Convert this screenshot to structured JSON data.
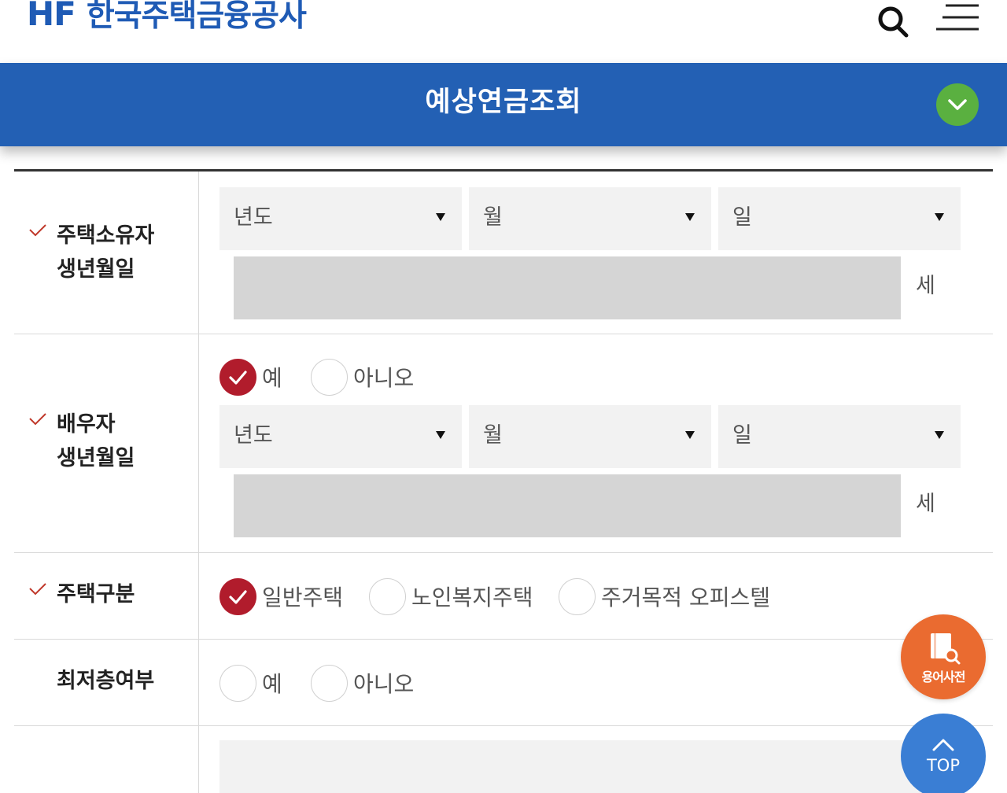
{
  "header": {
    "logo_abbr": "HF",
    "logo_name": "한국주택금융공사",
    "search_icon": "search-icon",
    "menu_icon": "hamburger-menu-icon"
  },
  "titlebar": {
    "title": "예상연금조회",
    "collapse_icon": "chevron-down-icon",
    "accent_color": "#2360b4",
    "button_color": "#5ab040"
  },
  "form": {
    "owner_birth": {
      "label": "주택소유자\n생년월일",
      "required": true,
      "year_placeholder": "년도",
      "month_placeholder": "월",
      "day_placeholder": "일",
      "age_value": "",
      "age_unit": "세"
    },
    "spouse_birth": {
      "label": "배우자\n생년월일",
      "required": true,
      "options": [
        {
          "label": "예",
          "checked": true
        },
        {
          "label": "아니오",
          "checked": false
        }
      ],
      "year_placeholder": "년도",
      "month_placeholder": "월",
      "day_placeholder": "일",
      "age_value": "",
      "age_unit": "세"
    },
    "house_type": {
      "label": "주택구분",
      "required": true,
      "options": [
        {
          "label": "일반주택",
          "checked": true
        },
        {
          "label": "노인복지주택",
          "checked": false
        },
        {
          "label": "주거목적 오피스텔",
          "checked": false
        }
      ]
    },
    "lowest_floor": {
      "label": "최저층여부",
      "required": false,
      "options": [
        {
          "label": "예",
          "checked": false
        },
        {
          "label": "아니오",
          "checked": false
        }
      ]
    }
  },
  "floating": {
    "dictionary_label": "용어사전",
    "dictionary_icon": "dictionary-search-icon",
    "dictionary_color": "#ea6b30",
    "top_label": "TOP",
    "top_icon": "chevron-up-icon",
    "top_color": "#3a7ed4"
  },
  "colors": {
    "checked_radio": "#b11c2c",
    "required_check": "#c0392b"
  }
}
